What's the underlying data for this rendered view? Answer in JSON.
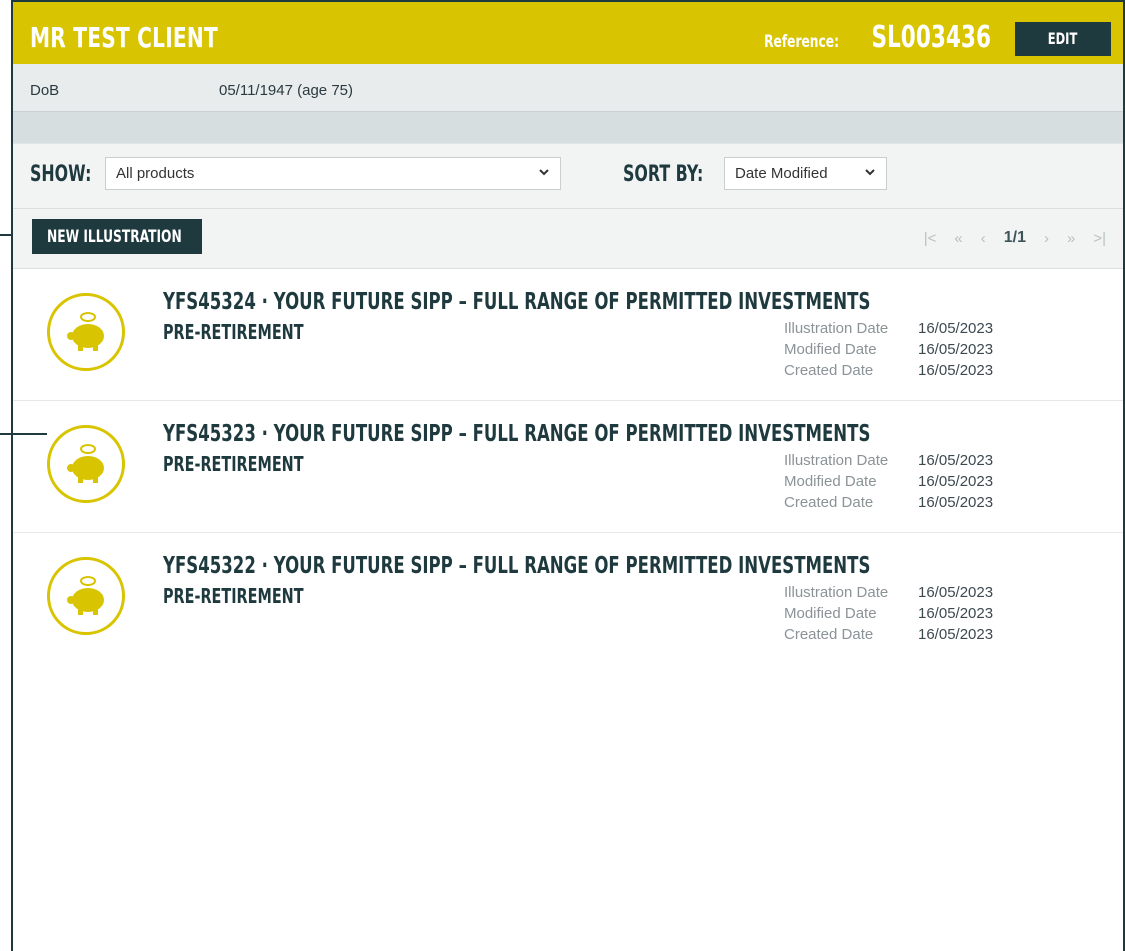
{
  "header": {
    "client_name": "MR TEST CLIENT",
    "reference_label": "Reference:",
    "reference_value": "SL003436",
    "edit_label": "EDIT"
  },
  "dob": {
    "label": "DoB",
    "value": "05/11/1947 (age 75)"
  },
  "filters": {
    "show_label": "SHOW:",
    "show_selected": "All products",
    "sort_label": "SORT BY:",
    "sort_selected": "Date Modified"
  },
  "actions": {
    "new_illustration_label": "NEW ILLUSTRATION"
  },
  "pager": {
    "first": "|<",
    "prev_page": "«",
    "prev": "‹",
    "current": "1/1",
    "next": "›",
    "next_page": "»",
    "last": ">|"
  },
  "items": [
    {
      "title": "YFS45324 · YOUR FUTURE SIPP – FULL RANGE OF PERMITTED INVESTMENTS",
      "subtitle": "PRE-RETIREMENT",
      "illustration_label": "Illustration Date",
      "illustration_date": "16/05/2023",
      "modified_label": "Modified Date",
      "modified_date": "16/05/2023",
      "created_label": "Created Date",
      "created_date": "16/05/2023"
    },
    {
      "title": "YFS45323 · YOUR FUTURE SIPP – FULL RANGE OF PERMITTED INVESTMENTS",
      "subtitle": "PRE-RETIREMENT",
      "illustration_label": "Illustration Date",
      "illustration_date": "16/05/2023",
      "modified_label": "Modified Date",
      "modified_date": "16/05/2023",
      "created_label": "Created Date",
      "created_date": "16/05/2023"
    },
    {
      "title": "YFS45322 · YOUR FUTURE SIPP – FULL RANGE OF PERMITTED INVESTMENTS",
      "subtitle": "PRE-RETIREMENT",
      "illustration_label": "Illustration Date",
      "illustration_date": "16/05/2023",
      "modified_label": "Modified Date",
      "modified_date": "16/05/2023",
      "created_label": "Created Date",
      "created_date": "16/05/2023"
    }
  ],
  "colors": {
    "brand_yellow": "#d8c400",
    "dark_teal": "#1f3a3f",
    "row_grey": "#e8ecec"
  },
  "icons": {
    "item_icon": "piggy-bank-icon",
    "select_chevron": "chevron-down-icon"
  }
}
